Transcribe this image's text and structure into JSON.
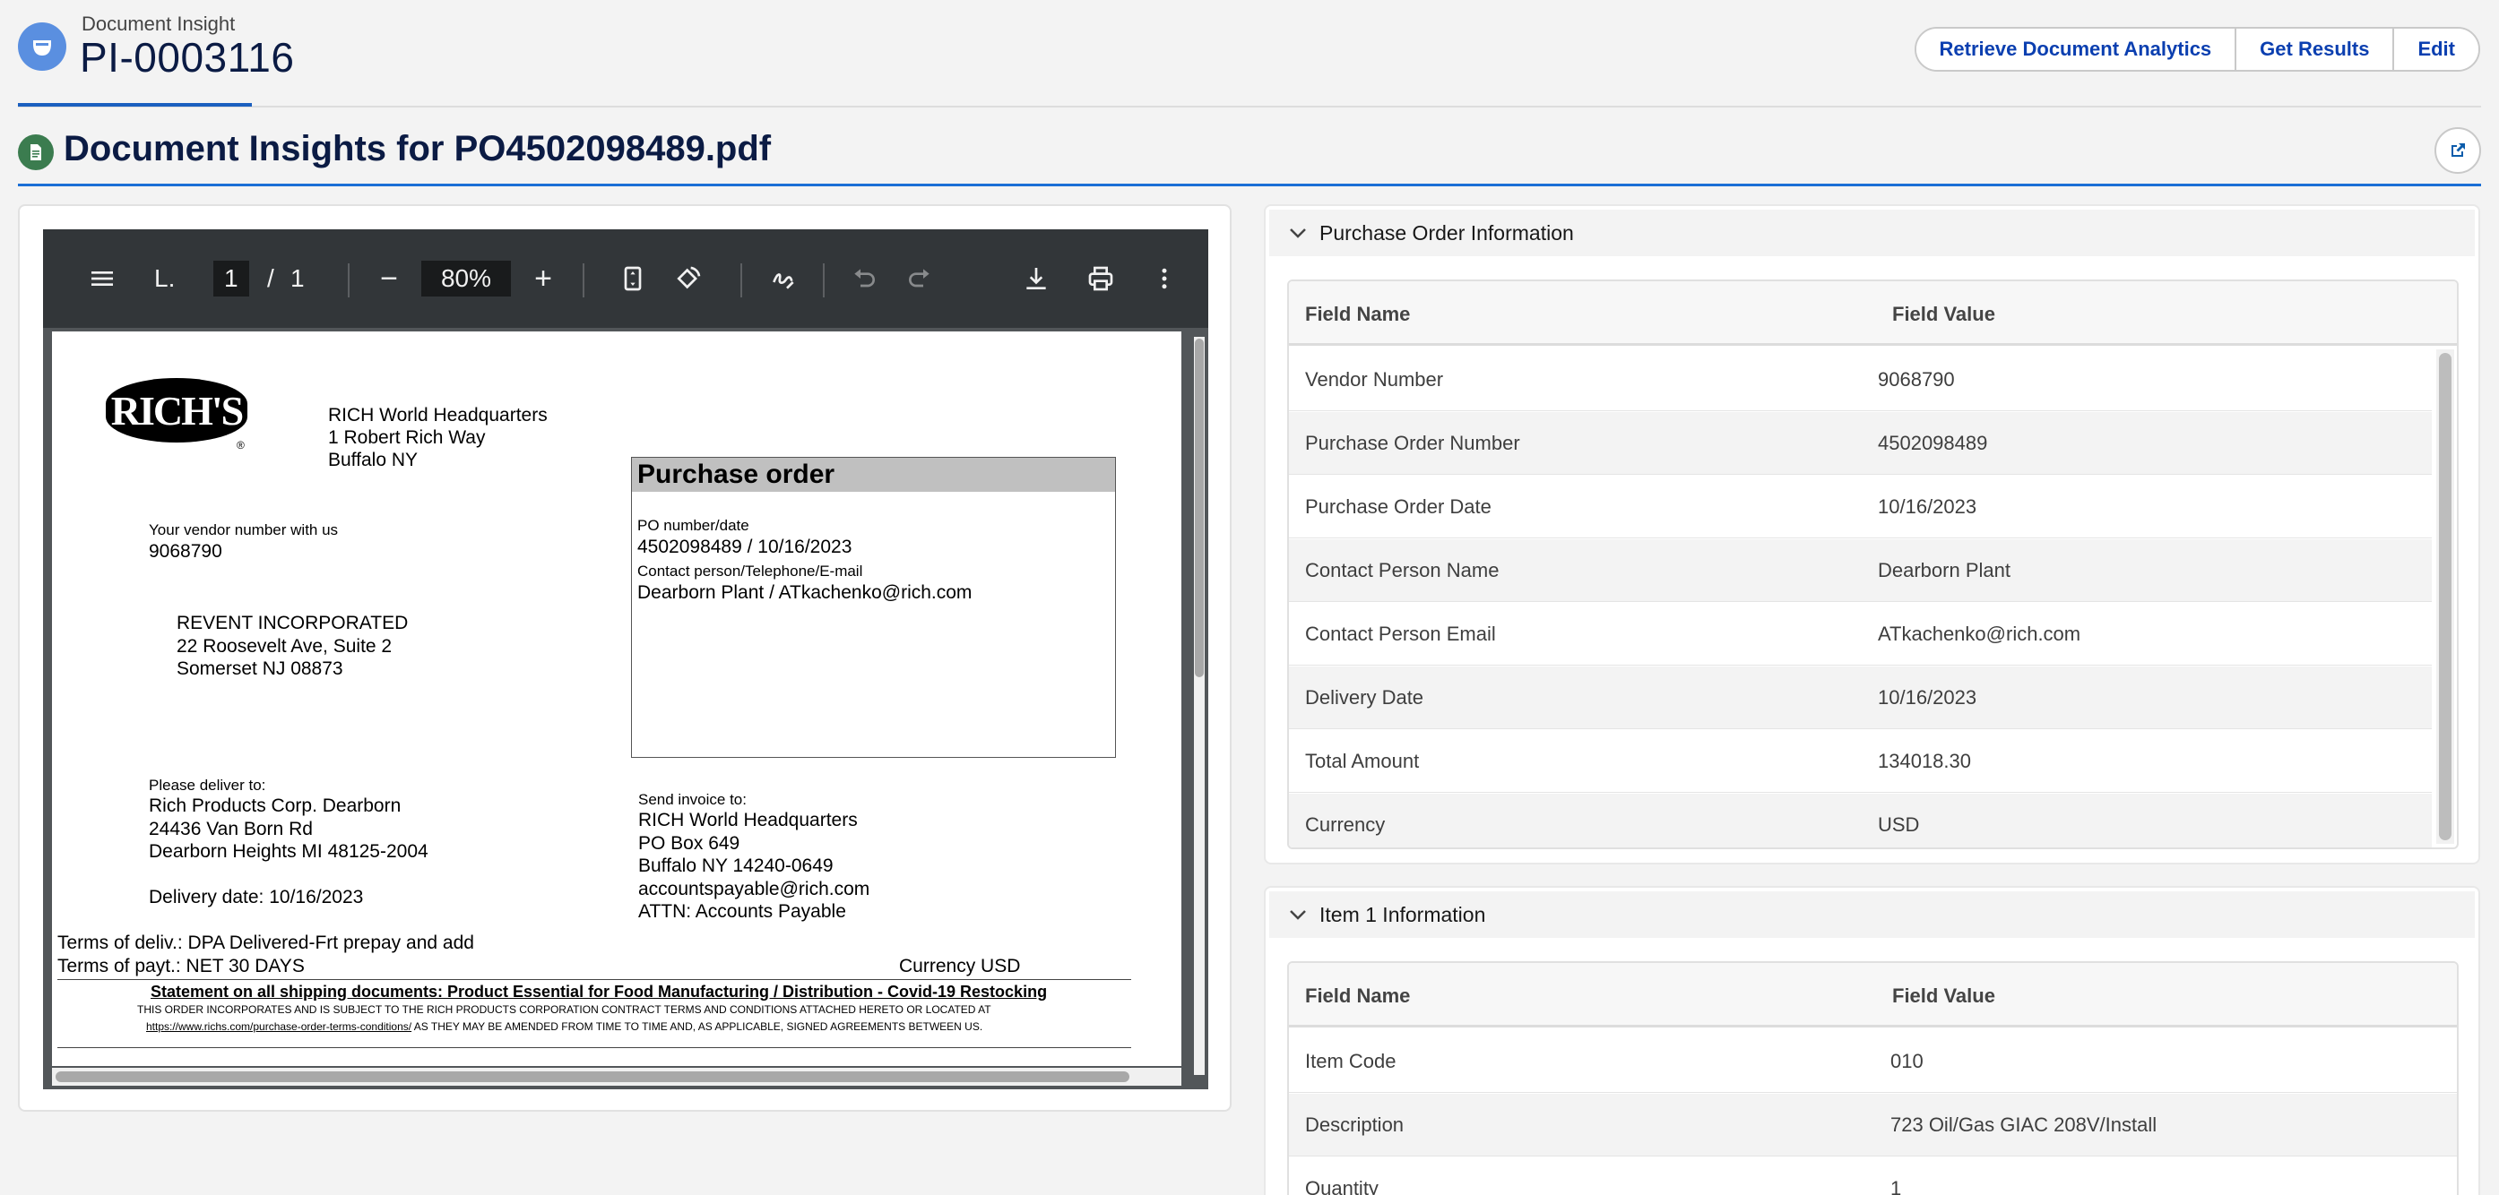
{
  "header": {
    "object_type": "Document Insight",
    "record_name": "PI-0003116",
    "actions": [
      "Retrieve Document Analytics",
      "Get Results",
      "Edit"
    ]
  },
  "card": {
    "title": "Document Insights for PO4502098489.pdf"
  },
  "pdf_viewer": {
    "doc_title": "L.",
    "page_current": "1",
    "page_total": "1",
    "page_sep": "/",
    "zoom": "80%",
    "zoom_minus": "−",
    "zoom_plus": "+"
  },
  "pdf_page": {
    "logo_text": "RICH'S",
    "logo_mark": "®",
    "hq": [
      "RICH World Headquarters",
      "1 Robert Rich Way",
      "Buffalo NY"
    ],
    "vendor_label": "Your vendor number with us",
    "vendor_number": "9068790",
    "vendor_address": [
      "REVENT INCORPORATED",
      "22 Roosevelt Ave, Suite 2",
      "Somerset NJ  08873"
    ],
    "po_heading": "Purchase order",
    "po_number_label": "PO number/date",
    "po_number_value": "4502098489 / 10/16/2023",
    "contact_label": "Contact person/Telephone/E-mail",
    "contact_value": "Dearborn Plant / ATkachenko@rich.com",
    "deliver_label": "Please deliver to:",
    "deliver_address": [
      "Rich Products Corp. Dearborn",
      "24436 Van Born Rd",
      "Dearborn Heights MI  48125-2004"
    ],
    "delivery_date": "Delivery date:   10/16/2023",
    "invoice_label": "Send invoice to:",
    "invoice_address": [
      "RICH World Headquarters",
      "PO Box 649",
      "Buffalo NY  14240-0649",
      "accountspayable@rich.com",
      "ATTN: Accounts Payable"
    ],
    "terms_deliv": "Terms of deliv.: DPA Delivered-Frt prepay and add",
    "terms_payt": "Terms of payt.: NET 30 DAYS",
    "currency": "Currency USD",
    "statement": "Statement on all shipping documents: Product Essential for Food Manufacturing / Distribution - Covid-19 Restocking",
    "fine_1": "THIS ORDER INCORPORATES AND IS SUBJECT TO THE RICH PRODUCTS CORPORATION CONTRACT TERMS AND CONDITIONS ATTACHED HERETO OR LOCATED AT",
    "fine_2_link": "https://www.richs.com/purchase-order-terms-conditions/",
    "fine_2_rest": " AS THEY MAY BE AMENDED FROM TIME TO TIME AND, AS APPLICABLE, SIGNED AGREEMENTS BETWEEN US."
  },
  "po_section": {
    "title": "Purchase Order Information",
    "columns": [
      "Field Name",
      "Field Value"
    ],
    "rows": [
      {
        "name": "Vendor Number",
        "value": "9068790"
      },
      {
        "name": "Purchase Order Number",
        "value": "4502098489"
      },
      {
        "name": "Purchase Order Date",
        "value": "10/16/2023"
      },
      {
        "name": "Contact Person Name",
        "value": "Dearborn Plant"
      },
      {
        "name": "Contact Person Email",
        "value": "ATkachenko@rich.com"
      },
      {
        "name": "Delivery Date",
        "value": "10/16/2023"
      },
      {
        "name": "Total Amount",
        "value": "134018.30"
      },
      {
        "name": "Currency",
        "value": "USD"
      }
    ]
  },
  "item_section": {
    "title": "Item 1 Information",
    "columns": [
      "Field Name",
      "Field Value"
    ],
    "rows": [
      {
        "name": "Item Code",
        "value": "010"
      },
      {
        "name": "Description",
        "value": "723 Oil/Gas GIAC 208V/Install"
      },
      {
        "name": "Quantity",
        "value": "1"
      }
    ]
  },
  "colors": {
    "brand_blue": "#1b5fbf",
    "button_text": "#0b3fb0",
    "doc_icon_green": "#3b7c4f",
    "record_icon_blue": "#5a8fe0"
  },
  "icons": [
    "record-icon",
    "document-icon",
    "popout-icon",
    "menu-icon",
    "fit-page-icon",
    "rotate-icon",
    "annotate-icon",
    "undo-icon",
    "redo-icon",
    "download-icon",
    "print-icon",
    "more-icon",
    "chevron-down-icon"
  ]
}
